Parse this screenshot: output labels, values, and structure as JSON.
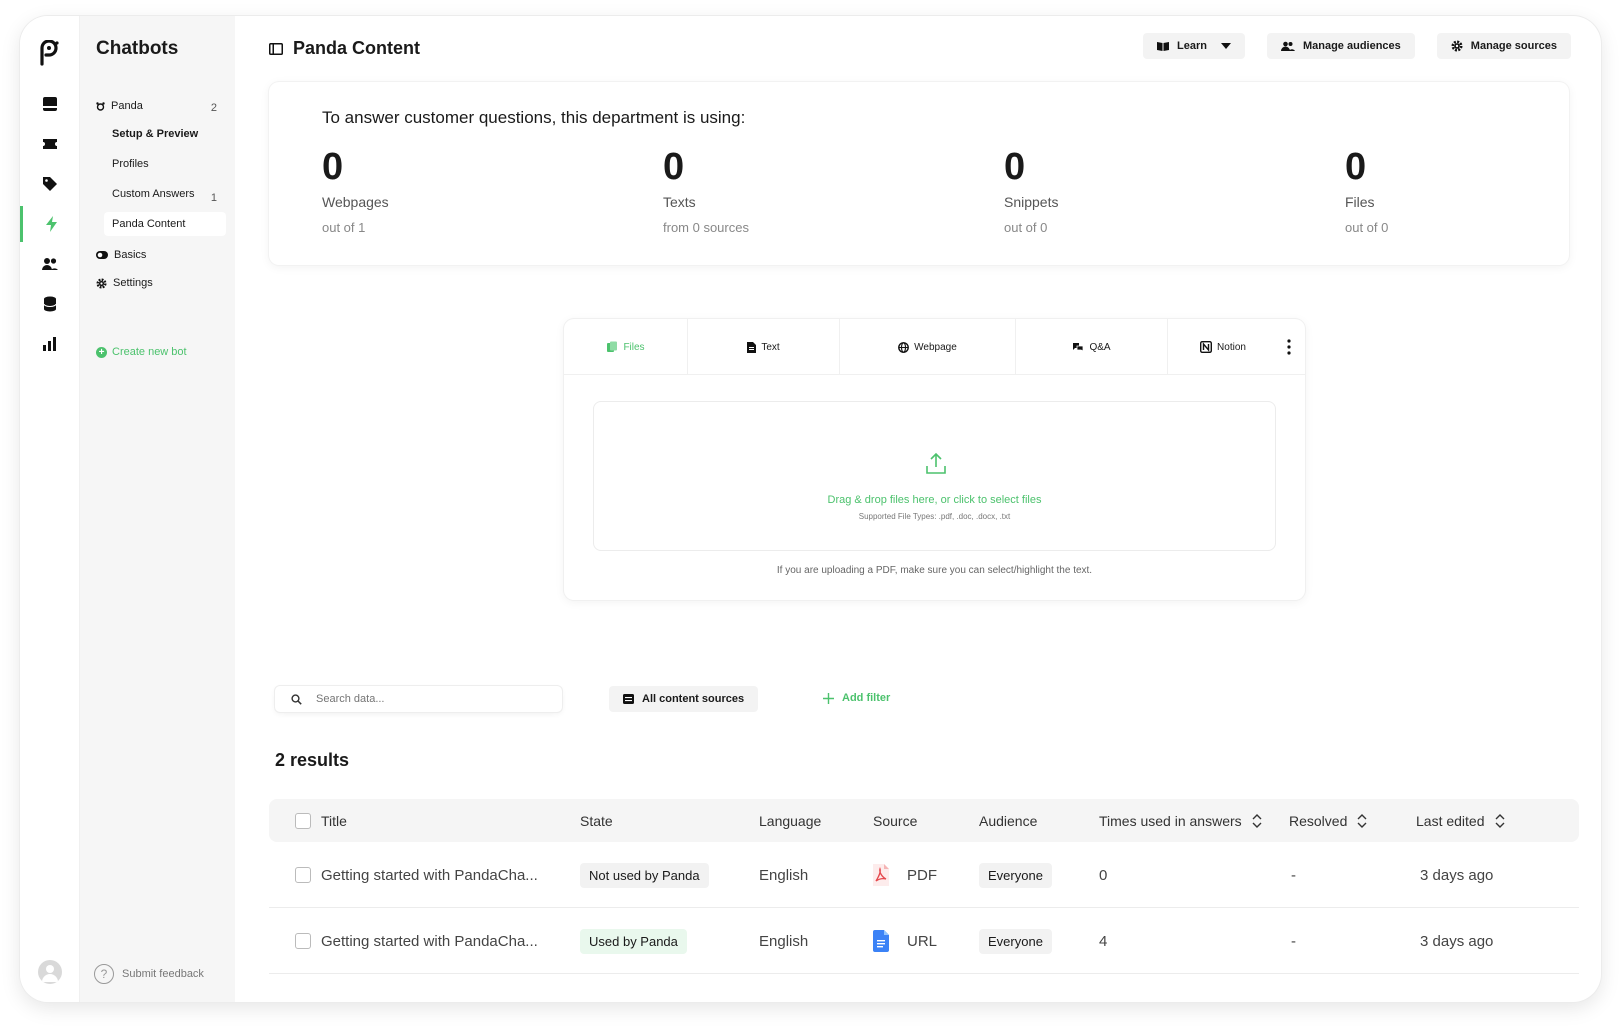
{
  "sidebar": {
    "title": "Chatbots",
    "bot": {
      "name": "Panda",
      "count": "2"
    },
    "children": [
      {
        "label": "Setup & Preview",
        "count": ""
      },
      {
        "label": "Profiles",
        "count": ""
      },
      {
        "label": "Custom Answers",
        "count": "1"
      },
      {
        "label": "Panda Content",
        "count": ""
      }
    ],
    "basics": "Basics",
    "settings": "Settings",
    "create": "Create new bot",
    "feedback": "Submit feedback"
  },
  "header": {
    "title": "Panda Content",
    "learn": "Learn",
    "manage_audiences": "Manage audiences",
    "manage_sources": "Manage sources"
  },
  "stats": {
    "lead": "To answer customer questions, this department is using:",
    "items": [
      {
        "value": "0",
        "label": "Webpages",
        "note": "out of 1"
      },
      {
        "value": "0",
        "label": "Texts",
        "note": "from 0 sources"
      },
      {
        "value": "0",
        "label": "Snippets",
        "note": "out of 0"
      },
      {
        "value": "0",
        "label": "Files",
        "note": "out of 0"
      }
    ]
  },
  "upload": {
    "tabs": [
      "Files",
      "Text",
      "Webpage",
      "Q&A",
      "Notion"
    ],
    "active_tab": "Files",
    "drop_text": "Drag & drop files here, or click to select files",
    "supported": "Supported File Types: .pdf, .doc, .docx, .txt",
    "tip": "If you are uploading a PDF, make sure you can select/highlight the text."
  },
  "filters": {
    "search_placeholder": "Search data...",
    "sources": "All content sources",
    "add_filter": "Add filter"
  },
  "results": "2 results",
  "table": {
    "columns": [
      "Title",
      "State",
      "Language",
      "Source",
      "Audience",
      "Times used in answers",
      "Resolved",
      "Last edited"
    ],
    "rows": [
      {
        "title": "Getting started with PandaCha...",
        "state": "Not used by Panda",
        "language": "English",
        "source": "PDF",
        "audience": "Everyone",
        "times": "0",
        "resolved": "-",
        "edited": "3 days ago"
      },
      {
        "title": "Getting started with PandaCha...",
        "state": "Used by Panda",
        "language": "English",
        "source": "URL",
        "audience": "Everyone",
        "times": "4",
        "resolved": "-",
        "edited": "3 days ago"
      }
    ]
  },
  "colors": {
    "accent": "#4cc26d",
    "pdf": "#e5484d",
    "doc": "#3b82f6"
  }
}
